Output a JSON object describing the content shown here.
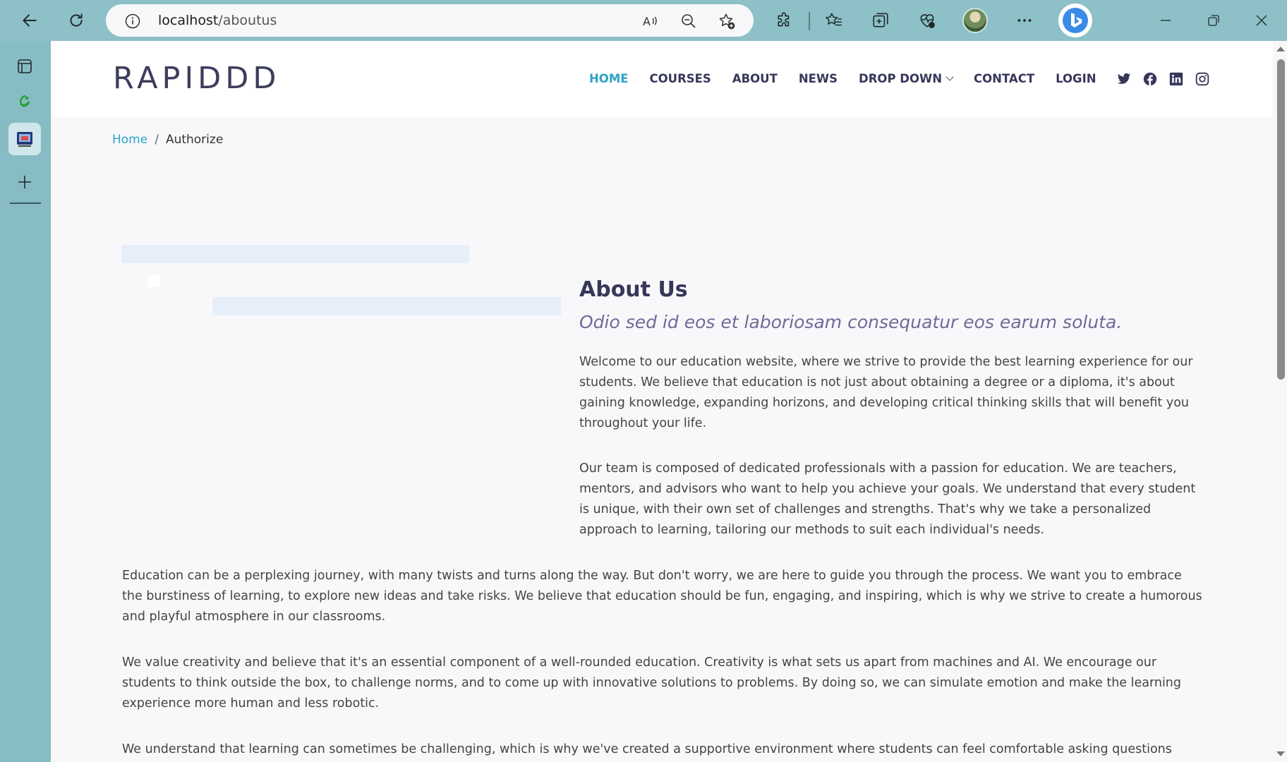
{
  "browser": {
    "url_host": "localhost",
    "url_path": "/aboutus"
  },
  "site": {
    "logo": "RAPIDDD",
    "nav": {
      "home": "HOME",
      "courses": "COURSES",
      "about": "ABOUT",
      "news": "NEWS",
      "dropdown": "DROP DOWN",
      "contact": "CONTACT",
      "login": "LOGIN"
    },
    "accent_color": "#2ea3c4",
    "social_icons": [
      "twitter-icon",
      "facebook-icon",
      "linkedin-icon",
      "instagram-icon"
    ]
  },
  "breadcrumb": {
    "home": "Home",
    "separator": "/",
    "current": "Authorize"
  },
  "about": {
    "title": "About Us",
    "subtitle": "Odio sed id eos et laboriosam consequatur eos earum soluta.",
    "p1": "Welcome to our education website, where we strive to provide the best learning experience for our students. We believe that education is not just about obtaining a degree or a diploma, it's about gaining knowledge, expanding horizons, and developing critical thinking skills that will benefit you throughout your life.",
    "p2": "Our team is composed of dedicated professionals with a passion for education. We are teachers, mentors, and advisors who want to help you achieve your goals. We understand that every student is unique, with their own set of challenges and strengths. That's why we take a personalized approach to learning, tailoring our methods to suit each individual's needs.",
    "p3": "Education can be a perplexing journey, with many twists and turns along the way. But don't worry, we are here to guide you through the process. We want you to embrace the burstiness of learning, to explore new ideas and take risks. We believe that education should be fun, engaging, and inspiring, which is why we strive to create a humorous and playful atmosphere in our classrooms.",
    "p4": "We value creativity and believe that it's an essential component of a well-rounded education. Creativity is what sets us apart from machines and AI. We encourage our students to think outside the box, to challenge norms, and to come up with innovative solutions to problems. By doing so, we can simulate emotion and make the learning experience more human and less robotic.",
    "p5": "We understand that learning can sometimes be challenging, which is why we've created a supportive environment where students can feel comfortable asking questions"
  }
}
